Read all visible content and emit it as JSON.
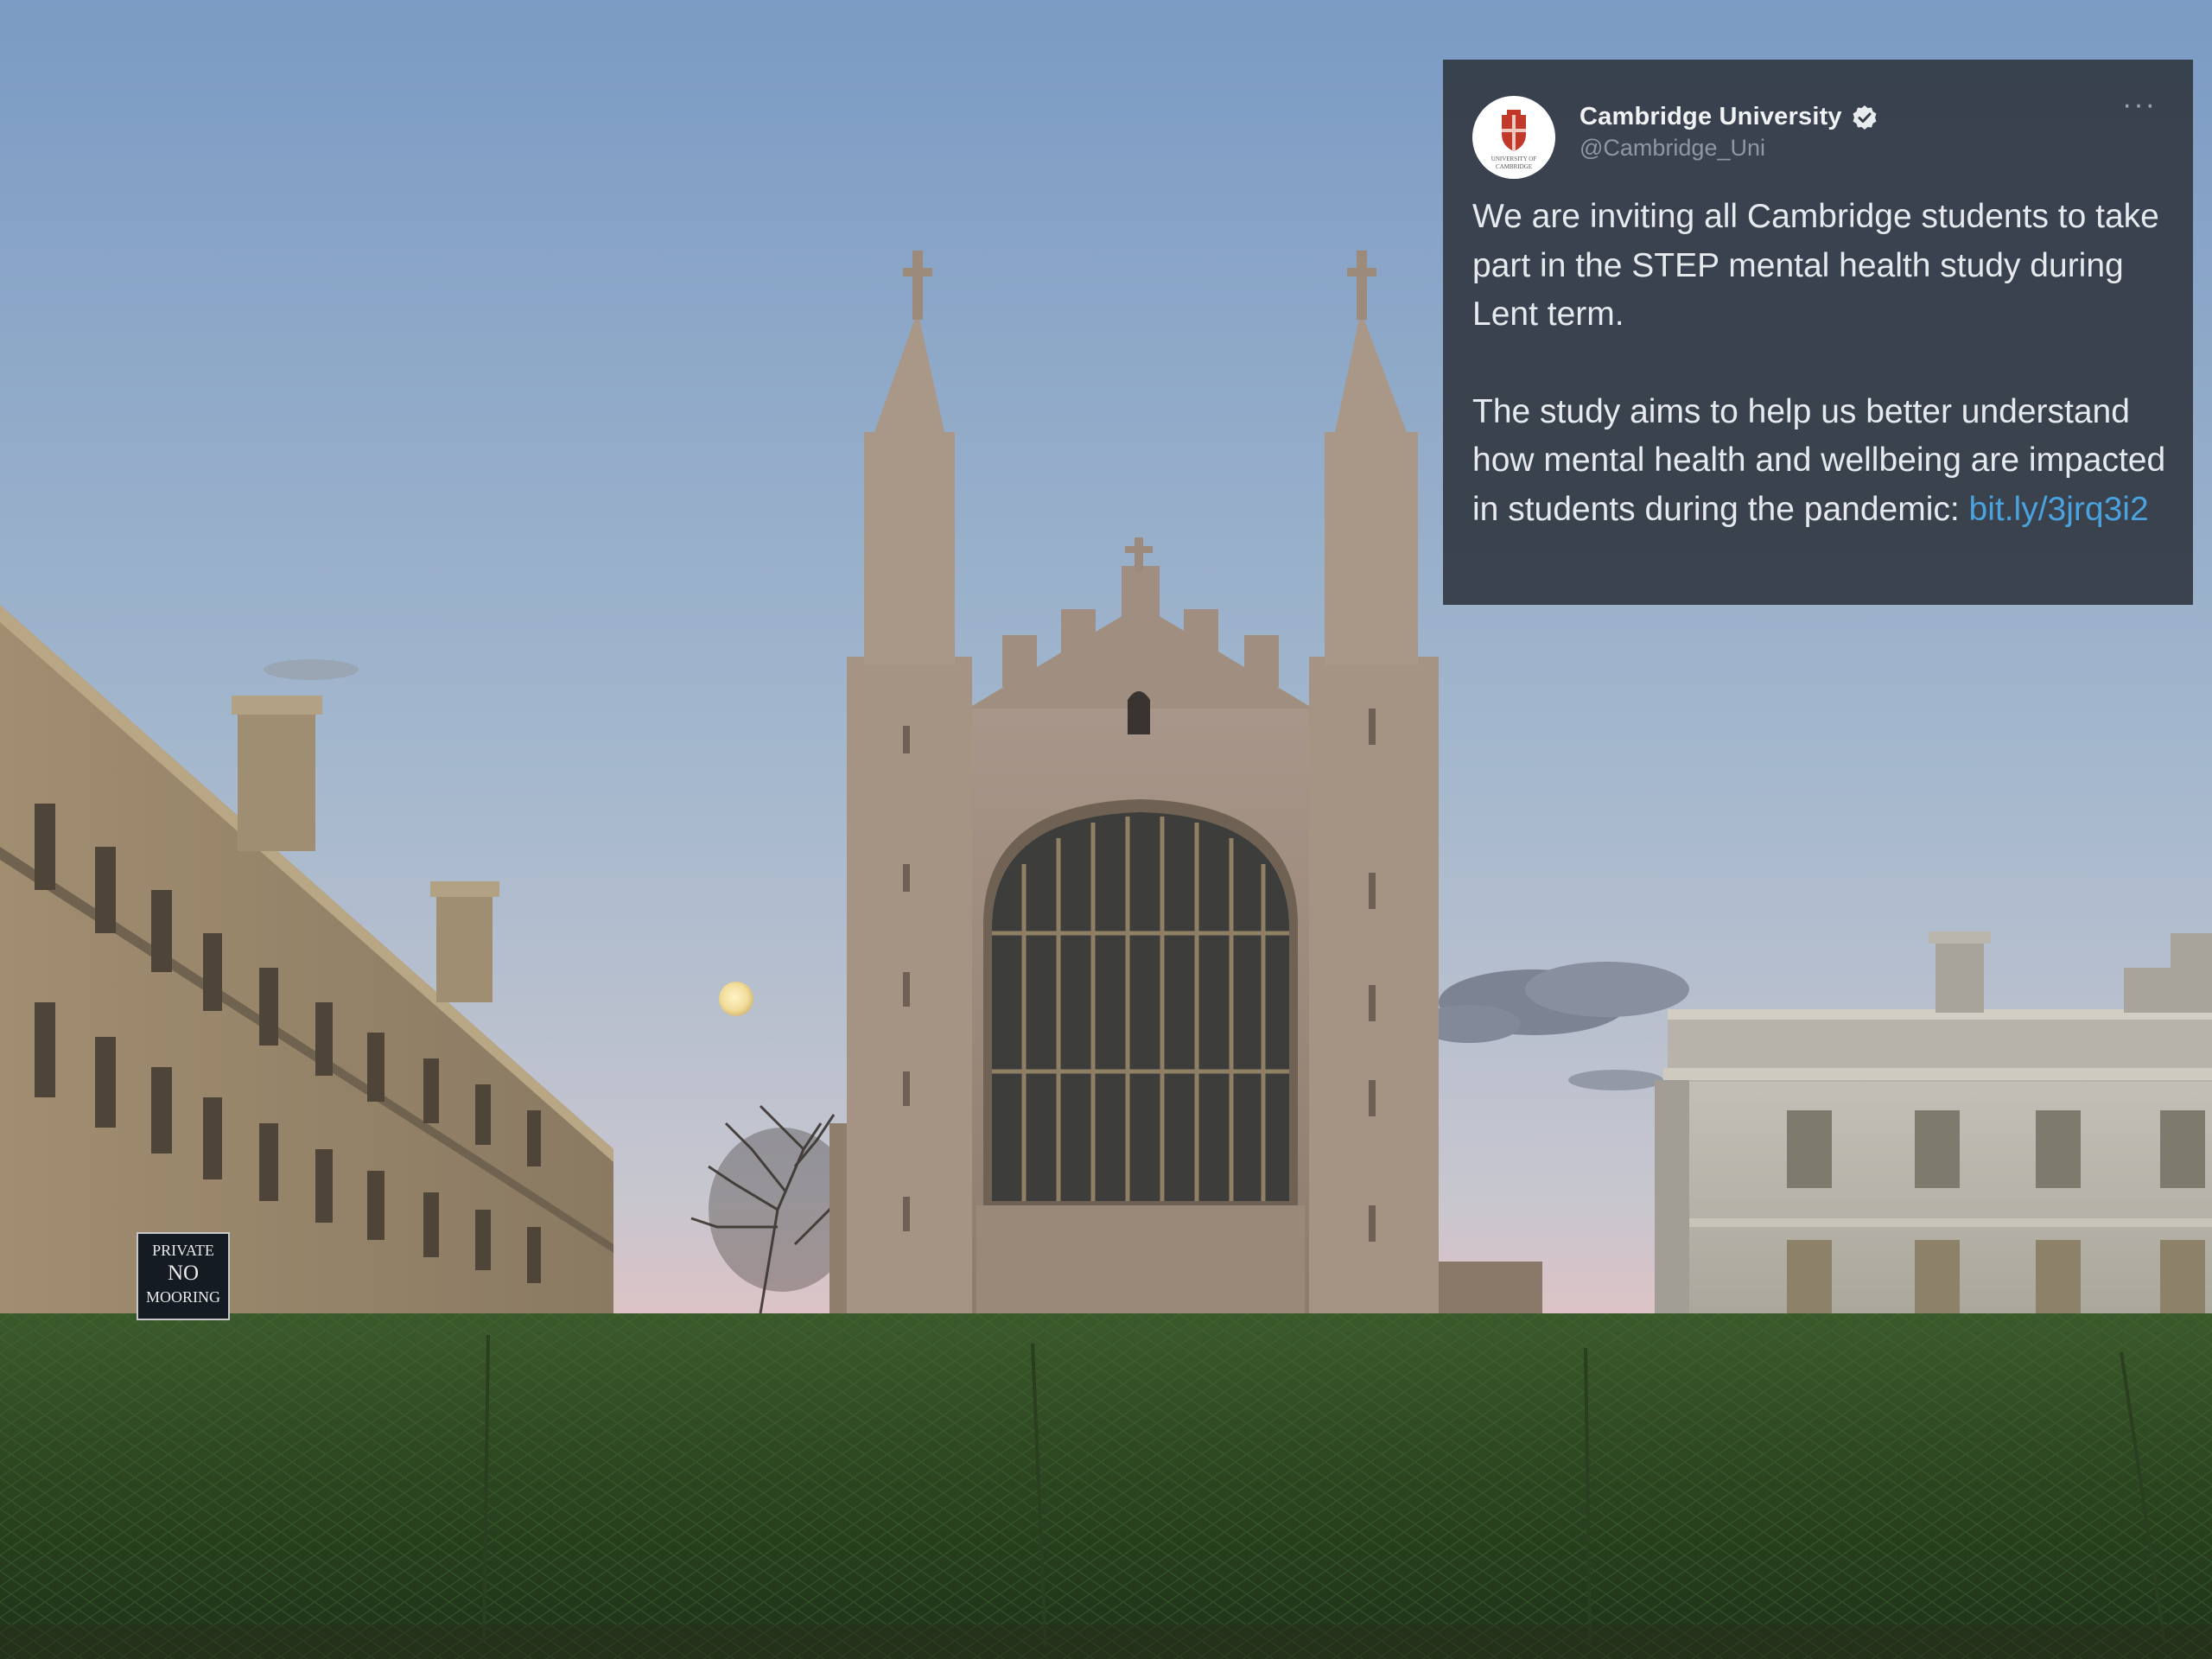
{
  "tweet": {
    "display_name": "Cambridge University",
    "handle": "@Cambridge_Uni",
    "verified_icon": "verified-badge-icon",
    "more_icon": "more-options-icon",
    "more_label": "···",
    "avatar_text_top": "UNIVERSITY OF",
    "avatar_text_bottom": "CAMBRIDGE",
    "paragraph_1": "We are inviting all Cambridge students to take part in the STEP mental health study during Lent term.",
    "paragraph_2_text": "The study aims to help us better understand how mental health and wellbeing are impacted in students during the pandemic: ",
    "link_text": "bit.ly/3jrq3i2",
    "colors": {
      "card_bg": "#343c46",
      "text": "#e6eaee",
      "handle": "#8d98a3",
      "link": "#4aa3df",
      "verified": "#e8ecef"
    }
  },
  "photo": {
    "sign_line_1": "PRIVATE",
    "sign_line_2": "NO",
    "sign_line_3": "MOORING",
    "colors": {
      "sky_top": "#7c9cc4",
      "sky_mid": "#a8b9cc",
      "sky_bottom": "#e3c1c1",
      "stone": "#b9a58d",
      "grass": "#2f4a24"
    }
  }
}
